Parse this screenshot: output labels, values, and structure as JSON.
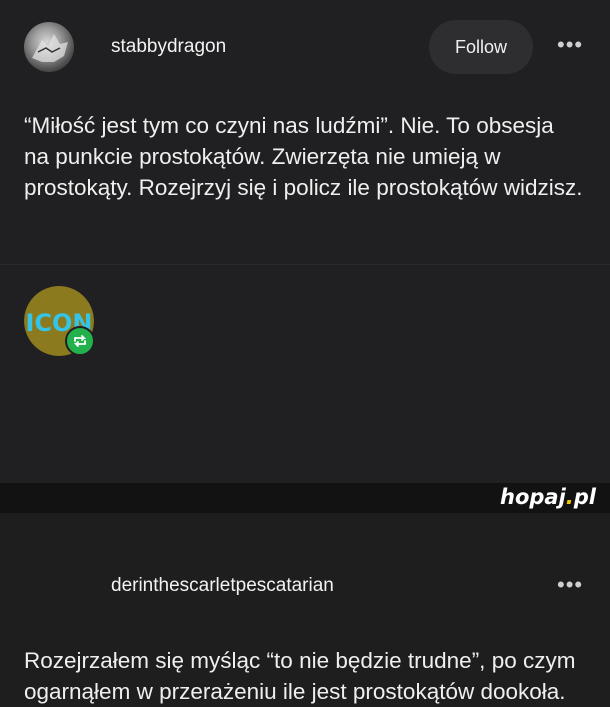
{
  "post1": {
    "username": "stabbydragon",
    "follow_label": "Follow",
    "more_label": "•••",
    "text": "“Miłość jest tym co czyni nas ludźmi”. Nie. To obsesja na punkcie prostokątów. Zwierzęta nie umieją w prostokąty. Rozejrzyj się i policz ile prostokątów widzisz."
  },
  "post2": {
    "username": "derinthescarletpescatarian",
    "avatar_text": "ICON",
    "more_label": "•••",
    "text": "Rozejrzałem się myśląc “to nie będzie trudne”, po czym ogarnąłem w przerażeniu ile jest prostokątów dookoła."
  },
  "colors": {
    "background": "#202022",
    "reblog_badge": "#22b14c",
    "watermark_dot": "#f5c800"
  },
  "watermark": {
    "name": "hopaj",
    "dot": ".",
    "tld": "pl"
  }
}
